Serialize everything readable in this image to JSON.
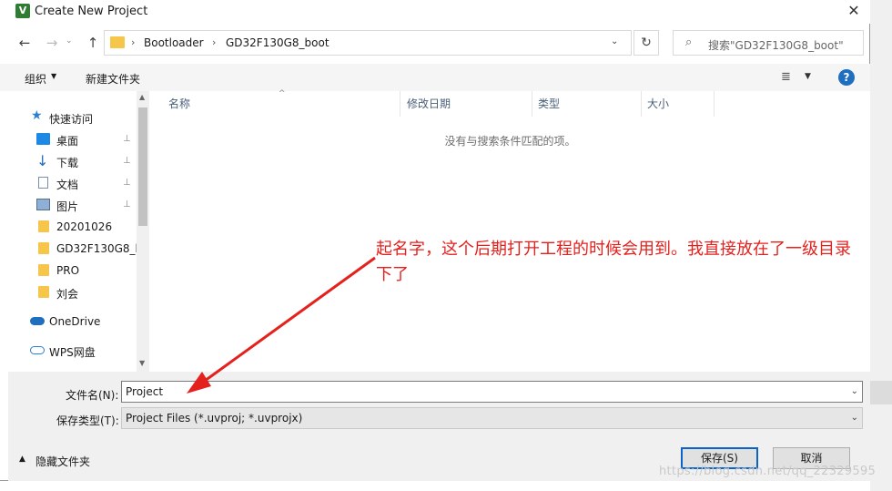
{
  "window": {
    "title": "Create New Project",
    "app_icon": "keil-uvision-icon",
    "close_glyph": "✕"
  },
  "nav": {
    "back": "←",
    "forward": "→",
    "recent": "⌄",
    "up": "↑"
  },
  "address": {
    "crumbs": [
      "Bootloader",
      "GD32F130G8_boot"
    ],
    "separator": "›",
    "dropdown": "⌄",
    "refresh": "↻"
  },
  "search": {
    "icon": "⌕",
    "placeholder": "搜索\"GD32F130G8_boot\""
  },
  "toolbar": {
    "organize": "组织",
    "organize_arrow": "▼",
    "new_folder": "新建文件夹",
    "view_icon": "≣",
    "view_arrow": "▼",
    "help": "?"
  },
  "sidebar": {
    "items": [
      {
        "label": "快速访问",
        "icon": "star-icon",
        "pinned": false
      },
      {
        "label": "桌面",
        "icon": "desktop-icon",
        "pinned": true
      },
      {
        "label": "下载",
        "icon": "download-icon",
        "pinned": true
      },
      {
        "label": "文档",
        "icon": "document-icon",
        "pinned": true
      },
      {
        "label": "图片",
        "icon": "pictures-icon",
        "pinned": true
      },
      {
        "label": "20201026",
        "icon": "folder-icon",
        "pinned": false
      },
      {
        "label": "GD32F130G8_b",
        "icon": "folder-icon",
        "pinned": false
      },
      {
        "label": "PRO",
        "icon": "folder-icon",
        "pinned": false
      },
      {
        "label": "刘会",
        "icon": "folder-icon",
        "pinned": false
      },
      {
        "label": "OneDrive",
        "icon": "cloud-icon",
        "pinned": false
      },
      {
        "label": "WPS网盘",
        "icon": "cloud-outline-icon",
        "pinned": false
      }
    ],
    "pin_glyph": "📌"
  },
  "columns": {
    "name": "名称",
    "date": "修改日期",
    "type": "类型",
    "size": "大小",
    "sort_glyph": "^"
  },
  "empty_message": "没有与搜索条件匹配的项。",
  "form": {
    "filename_label": "文件名(N):",
    "filename_value": "Project",
    "filetype_label": "保存类型(T):",
    "filetype_value": "Project Files (*.uvproj; *.uvprojx)",
    "dropdown_glyph": "⌄"
  },
  "footer": {
    "hide_folders": "隐藏文件夹",
    "hide_arrow": "▲",
    "save": "保存(S)",
    "cancel": "取消"
  },
  "annotation": {
    "text": "起名字，这个后期打开工程的时候会用到。我直接放在了一级目录下了",
    "color": "#e4211d"
  },
  "watermark": "https://blog.csdn.net/qq_22329595"
}
